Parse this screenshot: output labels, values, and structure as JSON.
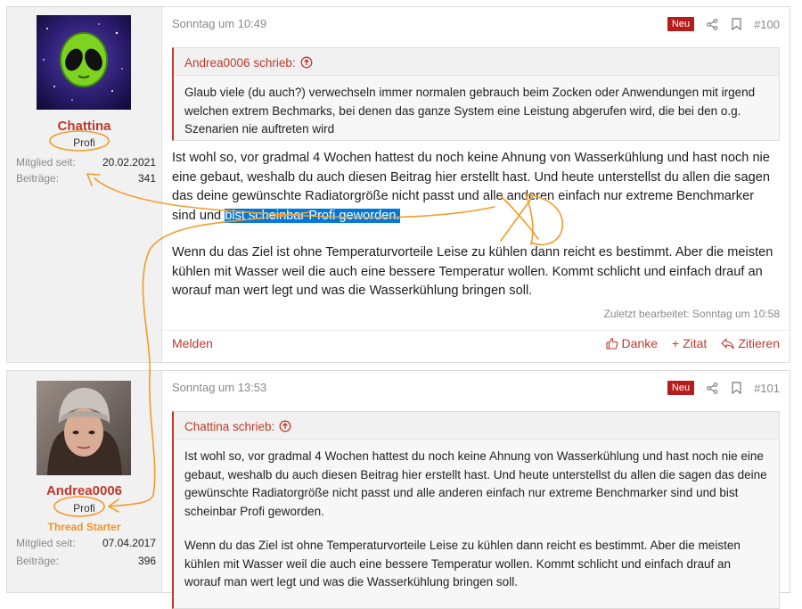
{
  "posts": [
    {
      "user": {
        "name": "Chattina",
        "title": "Profi",
        "member_since_label": "Mitglied seit:",
        "member_since": "20.02.2021",
        "posts_label": "Beiträge:",
        "posts": "341"
      },
      "date": "Sonntag um 10:49",
      "badge": "Neu",
      "number": "#100",
      "quote": {
        "author": "Andrea0006 schrieb:",
        "paragraphs": [
          "Glaub viele (du auch?) verwechseln immer normalen gebrauch beim Zocken oder Anwendungen mit irgend welchen extrem Bechmarks, bei denen das ganze System eine Leistung abgerufen wird, die bei den o.g. Szenarien nie auftreten wird"
        ]
      },
      "body": {
        "p1_pre": "Ist wohl so, vor gradmal 4 Wochen hattest du noch keine Ahnung von Wasserkühlung und hast noch nie eine gebaut, weshalb du auch diesen Beitrag hier erstellt hast. Und heute unterstellst du allen die sagen das deine gewünschte Radiatorgröße nicht passt und alle anderen einfach nur extreme Benchmarker sind und ",
        "p1_highlight": "bist scheinbar Profi geworden.",
        "p2": "Wenn du das Ziel ist ohne Temperaturvorteile Leise zu kühlen dann reicht es bestimmt. Aber die meisten kühlen mit Wasser weil die auch eine bessere Temperatur wollen. Kommt schlicht und einfach drauf an worauf man wert legt und was die Wasserkühlung bringen soll."
      },
      "last_edited": "Zuletzt bearbeitet: Sonntag um 10:58",
      "actions": {
        "report": "Melden",
        "like": "Danke",
        "quote": "+ Zitat",
        "reply": "Zitieren"
      }
    },
    {
      "user": {
        "name": "Andrea0006",
        "title": "Profi",
        "starter": "Thread Starter",
        "member_since_label": "Mitglied seit:",
        "member_since": "07.04.2017",
        "posts_label": "Beiträge:",
        "posts": "396"
      },
      "date": "Sonntag um 13:53",
      "badge": "Neu",
      "number": "#101",
      "quote": {
        "author": "Chattina schrieb:",
        "paragraphs": [
          "Ist wohl so, vor gradmal 4 Wochen hattest du noch keine Ahnung von Wasserkühlung und hast noch nie eine gebaut, weshalb du auch diesen Beitrag hier erstellt hast. Und heute unterstellst du allen die sagen das deine gewünschte Radiatorgröße nicht passt und alle anderen einfach nur extreme Benchmarker sind und bist scheinbar Profi geworden.",
          "Wenn du das Ziel ist ohne Temperaturvorteile Leise zu kühlen dann reicht es bestimmt. Aber die meisten kühlen mit Wasser weil die auch eine bessere Temperatur wollen. Kommt schlicht und einfach drauf an worauf man wert legt und was die Wasserkühlung bringen soll."
        ]
      }
    }
  ],
  "annotation": {
    "text": "xD",
    "color": "#f39b2a"
  },
  "colors": {
    "accent": "#c0392b",
    "badge": "#b71c1c",
    "highlight": "#0078d7",
    "starter": "#f7931e"
  }
}
